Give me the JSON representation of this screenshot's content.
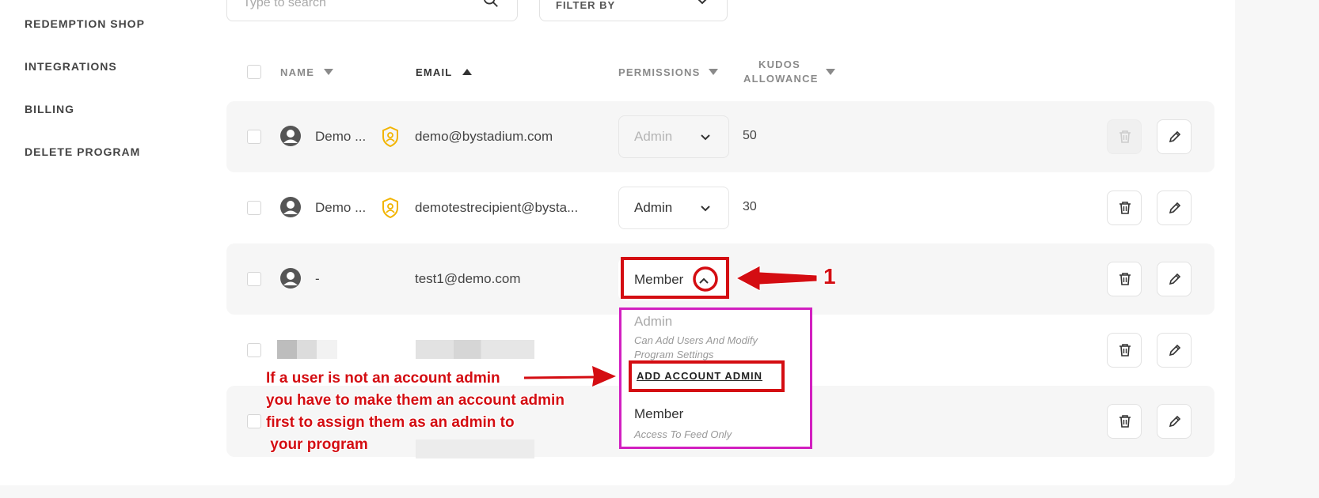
{
  "sidebar": {
    "items": [
      {
        "label": "REDEMPTION SHOP"
      },
      {
        "label": "INTEGRATIONS"
      },
      {
        "label": "BILLING"
      },
      {
        "label": "DELETE PROGRAM"
      }
    ]
  },
  "toolbar": {
    "search_placeholder": "Type to search",
    "filter_label": "FILTER BY"
  },
  "table": {
    "headers": {
      "name": "NAME",
      "email": "EMAIL",
      "permissions": "PERMISSIONS",
      "kudos_line1": "KUDOS",
      "kudos_line2": "ALLOWANCE"
    },
    "rows": [
      {
        "name": "Demo ...",
        "email": "demo@bystadium.com",
        "permission": "Admin",
        "kudos": "50"
      },
      {
        "name": "Demo ...",
        "email": "demotestrecipient@bysta...",
        "permission": "Admin",
        "kudos": "30"
      },
      {
        "name": "-",
        "email": "test1@demo.com",
        "permission": "Member",
        "kudos": ""
      }
    ]
  },
  "dropdown": {
    "admin_title": "Admin",
    "admin_desc_line1": "Can Add Users And Modify",
    "admin_desc_line2": "Program Settings",
    "add_account_admin": "ADD ACCOUNT ADMIN",
    "member_title": "Member",
    "member_desc": "Access To Feed Only"
  },
  "annotations": {
    "step_number": "1",
    "note_line1": "If a user is not an account admin",
    "note_line2": "you have to make them an account admin",
    "note_line3": "first to assign them as an admin to",
    "note_line4": " your program",
    "color": "#d40d12",
    "highlight_color": "#d21fc0"
  }
}
